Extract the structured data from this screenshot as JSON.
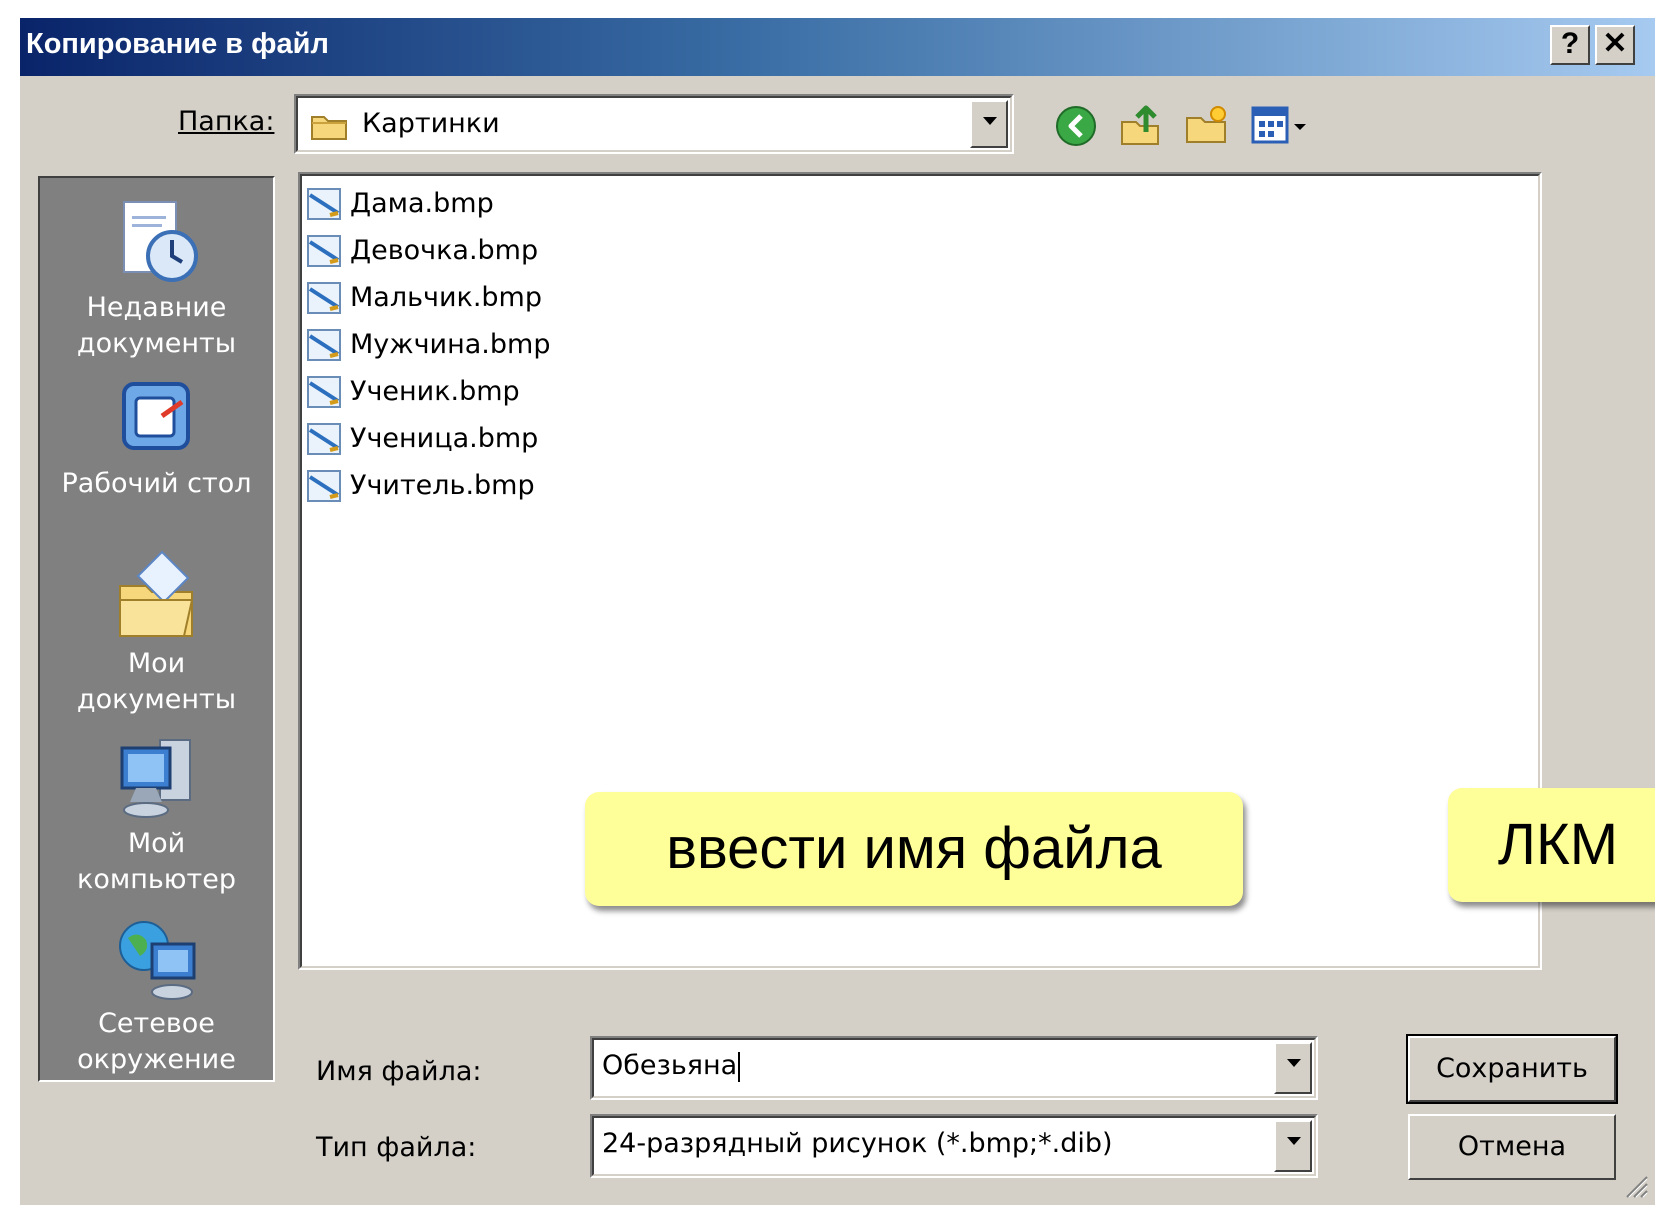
{
  "window": {
    "title": "Копирование в файл",
    "help_glyph": "?",
    "close_glyph": "✕"
  },
  "folder_bar": {
    "label": "Папка:",
    "current_folder": "Картинки",
    "toolbar_icons": [
      "back-icon",
      "up-folder-icon",
      "new-folder-icon",
      "view-menu-icon"
    ]
  },
  "places": [
    {
      "label_line1": "Недавние",
      "label_line2": "документы",
      "icon": "recent-documents-icon"
    },
    {
      "label_line1": "Рабочий стол",
      "label_line2": "",
      "icon": "desktop-icon"
    },
    {
      "label_line1": "Мои",
      "label_line2": "документы",
      "icon": "my-documents-icon"
    },
    {
      "label_line1": "Мой",
      "label_line2": "компьютер",
      "icon": "my-computer-icon"
    },
    {
      "label_line1": "Сетевое",
      "label_line2": "окружение",
      "icon": "network-icon"
    }
  ],
  "files": [
    "Дама.bmp",
    "Девочка.bmp",
    "Мальчик.bmp",
    "Мужчина.bmp",
    "Ученик.bmp",
    "Ученица.bmp",
    "Учитель.bmp"
  ],
  "filename": {
    "label": "Имя файла:",
    "value": "Обезьяна"
  },
  "filetype": {
    "label": "Тип файла:",
    "value": "24-разрядный рисунок (*.bmp;*.dib)"
  },
  "buttons": {
    "save": "Сохранить",
    "cancel": "Отмена"
  },
  "callouts": {
    "enter_name": "ввести имя файла",
    "lmb": "ЛКМ"
  },
  "colors": {
    "title_gradient_start": "#0a246a",
    "title_gradient_end": "#a6caf0",
    "dialog_face": "#d4d0c8",
    "places_bar": "#808080",
    "callout": "#ffff99"
  }
}
